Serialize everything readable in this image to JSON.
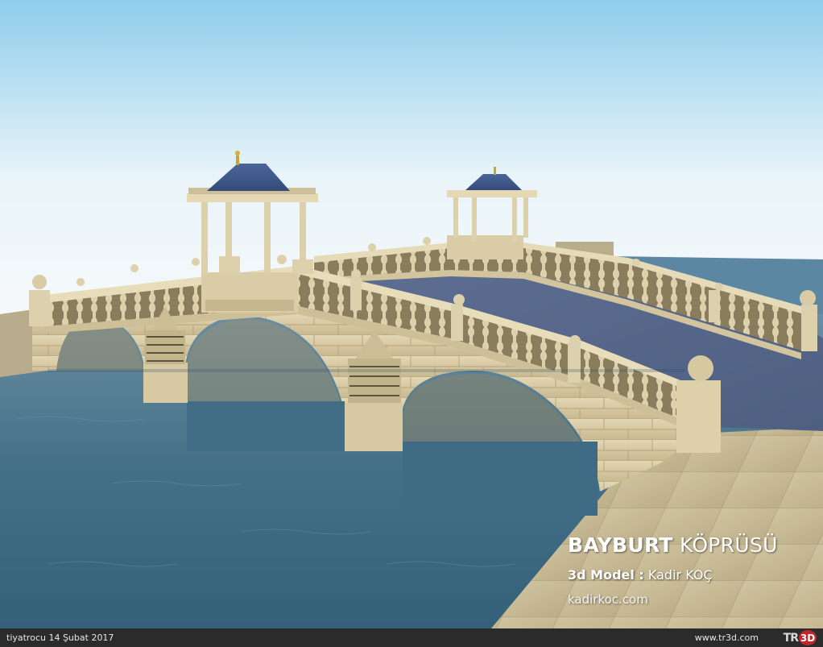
{
  "image": {
    "subject": "3D render of a stone arched bridge with two gazebo pavilions over water"
  },
  "overlay": {
    "title_bold": "BAYBURT",
    "title_rest": " KÖPRÜSÜ",
    "credit_label": "3d Model :",
    "credit_name": " Kadir KOÇ",
    "website": "kadirkoc.com"
  },
  "footer": {
    "uploader": "tiyatrocu 14 Şubat 2017",
    "site_url": "www.tr3d.com",
    "logo_text": "TR",
    "logo_badge": "3D"
  },
  "colors": {
    "sky_top": "#8ecdeb",
    "sky_bottom": "#f2f8fb",
    "water": "#3f6b85",
    "stone": "#d6c8a3",
    "roof": "#3f5a8c",
    "footer_bg": "#2b2b2b",
    "logo_red": "#c0262b"
  }
}
